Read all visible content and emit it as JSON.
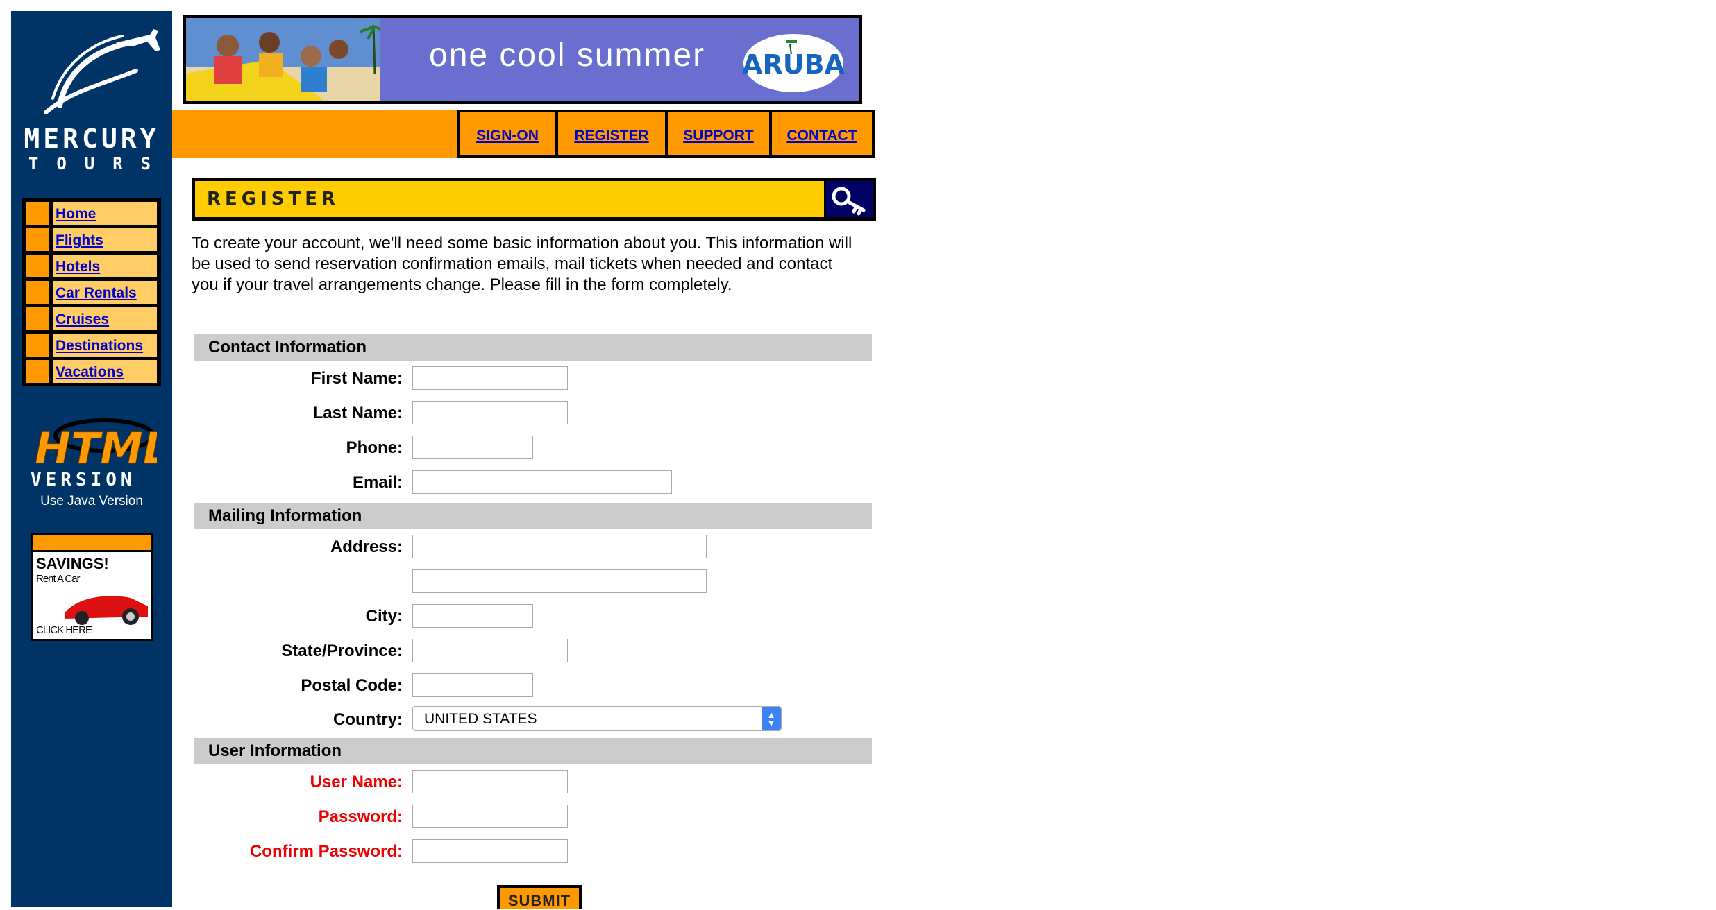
{
  "brand": {
    "name_line1": "MERCURY",
    "name_line2": "TOURS"
  },
  "sidebar": {
    "nav": [
      {
        "label": "Home"
      },
      {
        "label": "Flights"
      },
      {
        "label": "Hotels"
      },
      {
        "label": "Car Rentals"
      },
      {
        "label": "Cruises"
      },
      {
        "label": "Destinations"
      },
      {
        "label": "Vacations"
      }
    ],
    "html_version_logo_text": "HTML VERSION",
    "java_link": "Use Java Version",
    "savings_ad": {
      "title": "SAVINGS!",
      "subtitle": "Rent A Car",
      "cta": "CLICK HERE"
    }
  },
  "banner": {
    "slogan": "one cool summer",
    "logo_text": "ARUBA"
  },
  "top_nav": [
    {
      "label": "SIGN-ON"
    },
    {
      "label": "REGISTER"
    },
    {
      "label": "SUPPORT"
    },
    {
      "label": "CONTACT"
    }
  ],
  "page": {
    "title": "REGISTER",
    "intro": "To create your account, we'll need some basic information about you. This information will be used to send reservation confirmation emails, mail tickets when needed and contact you if your travel arrangements change. Please fill in the form completely."
  },
  "form": {
    "contact": {
      "heading": "Contact Information",
      "first_name": {
        "label": "First Name:",
        "value": ""
      },
      "last_name": {
        "label": "Last Name:",
        "value": ""
      },
      "phone": {
        "label": "Phone:",
        "value": ""
      },
      "email": {
        "label": "Email:",
        "value": ""
      }
    },
    "mailing": {
      "heading": "Mailing Information",
      "address": {
        "label": "Address:",
        "value1": "",
        "value2": ""
      },
      "city": {
        "label": "City:",
        "value": ""
      },
      "state": {
        "label": "State/Province:",
        "value": ""
      },
      "postal": {
        "label": "Postal Code:",
        "value": ""
      },
      "country": {
        "label": "Country:",
        "value": "UNITED STATES"
      }
    },
    "user": {
      "heading": "User Information",
      "username": {
        "label": "User Name:",
        "value": ""
      },
      "password": {
        "label": "Password:",
        "value": ""
      },
      "confirm": {
        "label": "Confirm Password:",
        "value": ""
      }
    },
    "submit_label": "SUBMIT"
  },
  "colors": {
    "sidebar_bg": "#003366",
    "nav_orange": "#ff9900",
    "nav_cell": "#ffcc66",
    "header_yellow": "#ffcc00",
    "section_gray": "#cccccc",
    "link_blue": "#0000cc",
    "required_red": "#ee0000",
    "banner_purple": "#6a6fcf"
  }
}
